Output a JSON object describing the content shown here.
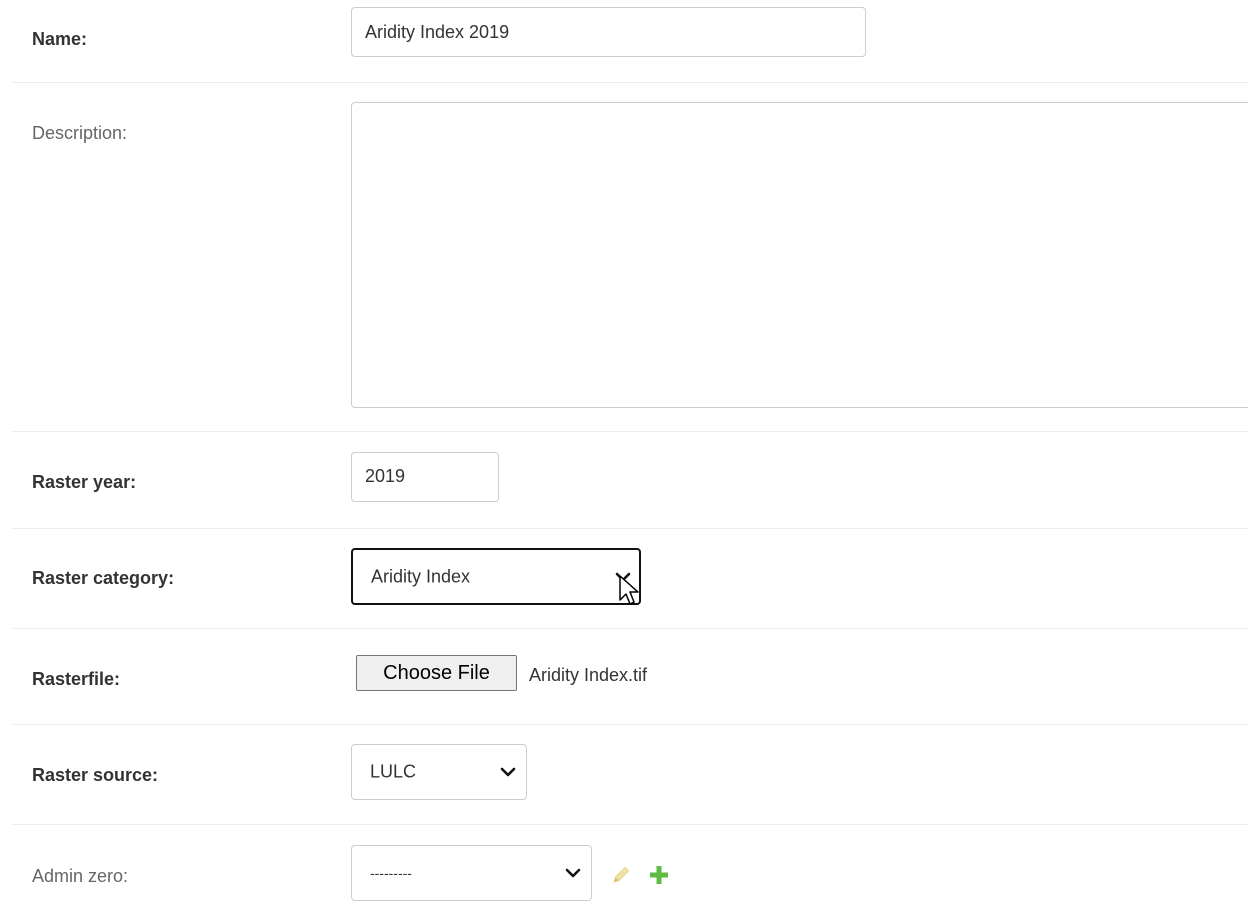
{
  "form": {
    "name": {
      "label": "Name:",
      "value": "Aridity Index 2019"
    },
    "description": {
      "label": "Description:",
      "value": ""
    },
    "raster_year": {
      "label": "Raster year:",
      "value": "2019"
    },
    "raster_category": {
      "label": "Raster category:",
      "selected": "Aridity Index"
    },
    "rasterfile": {
      "label": "Rasterfile:",
      "button_label": "Choose File",
      "file_name": "Aridity Index.tif"
    },
    "raster_source": {
      "label": "Raster source:",
      "selected": "LULC"
    },
    "admin_zero": {
      "label": "Admin zero:",
      "selected": "---------"
    }
  },
  "icons": {
    "edit": "pencil-icon",
    "add": "plus-icon",
    "dropdown": "chevron-down-icon",
    "cursor": "mouse-pointer-icon"
  },
  "colors": {
    "edit_icon": "#efe3a6",
    "add_icon": "#5fbb46",
    "border": "#cccccc",
    "focus_border": "#111111"
  }
}
